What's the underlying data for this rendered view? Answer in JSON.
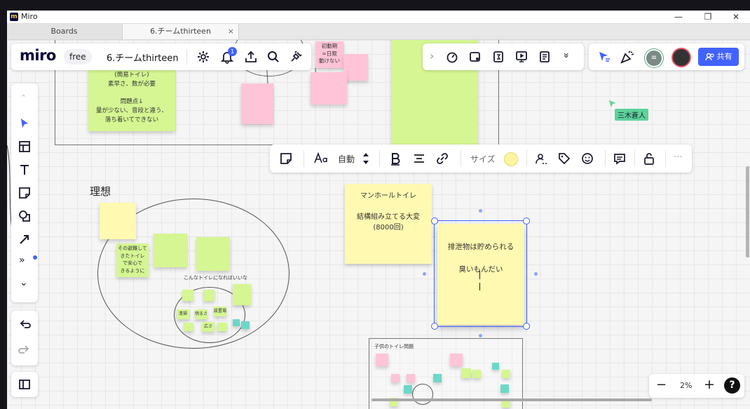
{
  "window": {
    "app_title": "Miro",
    "minimize": "—",
    "maximize": "❐",
    "close": "✕"
  },
  "tabs": [
    {
      "label": "Boards"
    },
    {
      "label": "6.チームthirteen"
    }
  ],
  "tab_close": "×",
  "header": {
    "brand": "miro",
    "plan": "free",
    "board_name": "6.チームthirteen",
    "notification_count": "1"
  },
  "top_right_toolbar": {
    "chevron": "›",
    "more": "»"
  },
  "collab": {
    "avatar_initial": "≡",
    "share_label": "共有"
  },
  "cursor_tag": "三木蒼人",
  "format_toolbar": {
    "font_size": "自動",
    "size_label": "サイズ",
    "more": "···"
  },
  "left_toolbar": {
    "collapse": "⌃",
    "more_tools": "»",
    "expand": "⌄"
  },
  "zoom": {
    "level": "2%",
    "minus": "−",
    "plus": "+",
    "help": "?"
  },
  "canvas": {
    "frame1_sticky_text": "(簡易トイレ)\n素早さ、数が必要\n\n問題点↓\n量が少ない、音段と違う、\n落ち着いてできない",
    "ideal_label": "理想",
    "sticky_manhole": "マンホールトイレ\n\n結構組み立てる大変\n(8000回)",
    "sticky_selected": "排泄物は貯められる\n\n臭いもんだい",
    "sticky_safe": "その避難して\nきたトイレ\nで安心で\nきるように",
    "sticky_pink_day": "初動期\n=日限\n動けない",
    "toilet_label": "こんなトイレになればいいな",
    "sub_label": "子供のトイレ問題",
    "sticky_small_a": "清掃",
    "sticky_small_b": "明るさ",
    "sticky_small_c": "設置場",
    "sticky_small_d": "広さ"
  },
  "colors": {
    "accent": "#4262ff",
    "sticky_yellow": "#fff9b1",
    "sticky_green": "#d5f692",
    "sticky_pink": "#ffc4d8",
    "cursor_green": "#5ed29a"
  }
}
